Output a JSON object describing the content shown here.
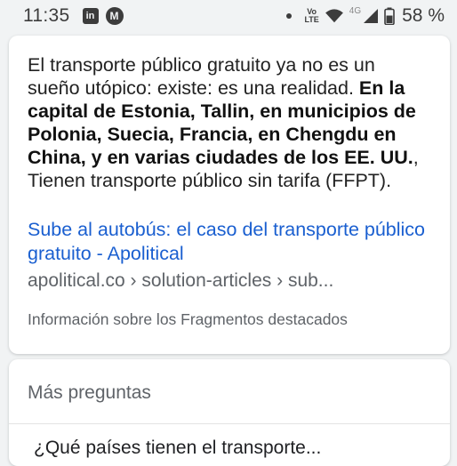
{
  "status_bar": {
    "time": "11:35",
    "left_icons": [
      "linkedin-icon",
      "motorola-icon"
    ],
    "volte_label": "Vo\nLTE",
    "network_small": "4G",
    "battery_percent": "58 %"
  },
  "featured_snippet": {
    "text_plain_1": "El transporte público gratuito ya no es un sueño utópico: existe: es una realidad. ",
    "text_bold": "En la capital de Estonia, Tallin, en municipios de Polonia, Suecia, Francia, en Chengdu en China, y en varias ciudades de los EE. UU.",
    "text_plain_2": ", Tienen transporte público sin tarifa (FFPT).",
    "link_title": "Sube al autobús: el caso del transporte público gratuito - Apolitical",
    "url_breadcrumb": "apolitical.co › solution-articles › sub...",
    "about_label": "Información sobre los Fragmentos destacados"
  },
  "more_questions": {
    "title": "Más preguntas",
    "first_question_peek": "¿Qué países tienen el transporte..."
  },
  "colors": {
    "background": "#f1f3f4",
    "link": "#1a5fd0",
    "secondary_text": "#5f6368"
  }
}
